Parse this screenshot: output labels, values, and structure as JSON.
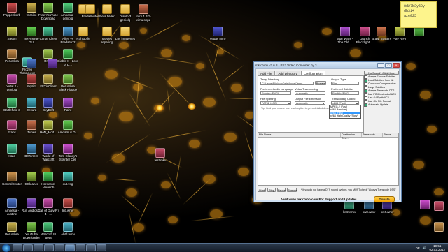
{
  "desktop": {
    "icons": [
      {
        "label": "Pappenkorb",
        "type": "file"
      },
      {
        "label": "Yorbiko",
        "type": "file"
      },
      {
        "label": "Free YouTube Download",
        "type": "file"
      },
      {
        "label": "Amnesia - geniolg",
        "type": "file"
      },
      {
        "label": "",
        "type": "folder"
      },
      {
        "label": "Freifallbilder",
        "type": "folder"
      },
      {
        "label": "Beta bilder",
        "type": "folder"
      },
      {
        "label": "Diablo 3 geniolg",
        "type": "folder"
      },
      {
        "label": "Intro 1 4G-vimu.shpd",
        "type": "file"
      },
      {
        "label": "Steam",
        "type": "file"
      },
      {
        "label": "mkvmerge GUI",
        "type": "file"
      },
      {
        "label": "Curse Client",
        "type": "file"
      },
      {
        "label": "Alien vs Predator 2",
        "type": "file"
      },
      {
        "label": "Rohstoffe",
        "type": "folder"
      },
      {
        "label": "Movies reparing",
        "type": "folder"
      },
      {
        "label": "Los imagenes",
        "type": "folder"
      },
      {
        "label": "Perumbra",
        "type": "file"
      },
      {
        "label": "Origin",
        "type": "file"
      },
      {
        "label": "Diablo II - Lord of D...",
        "type": "file"
      },
      {
        "label": "Frozen Throne.exe",
        "type": "file"
      },
      {
        "label": "",
        "type": "file"
      },
      {
        "label": "",
        "type": "file"
      },
      {
        "label": "portal 2 - geniolg",
        "type": "file"
      },
      {
        "label": "Skyrim",
        "type": "file"
      },
      {
        "label": "FFXivClient",
        "type": "file"
      },
      {
        "label": "Perumbra Black Plague",
        "type": "file"
      },
      {
        "label": "Battlefield 3",
        "type": "file"
      },
      {
        "label": "Dexura",
        "type": "file"
      },
      {
        "label": "SkyDrift",
        "type": "file"
      },
      {
        "label": "Paint",
        "type": "file"
      },
      {
        "label": "Fraps",
        "type": "file"
      },
      {
        "label": "iTunes",
        "type": "file"
      },
      {
        "label": "HoN_Mod...",
        "type": "file"
      },
      {
        "label": "Amdamus D...",
        "type": "file"
      },
      {
        "label": "Halo",
        "type": "file"
      },
      {
        "label": "BitTorrent",
        "type": "file"
      },
      {
        "label": "World of Warcraft",
        "type": "file"
      },
      {
        "label": "Tom Clancy's Splinter Cell",
        "type": "file"
      },
      {
        "label": "test.mkv",
        "type": "file"
      },
      {
        "label": "ControlCenter",
        "type": "file"
      },
      {
        "label": "CCleaner",
        "type": "file"
      },
      {
        "label": "Heroes of Newerth",
        "type": "file"
      },
      {
        "label": "out.vog",
        "type": "file"
      },
      {
        "label": "Amnesia - Justine",
        "type": "file"
      },
      {
        "label": "Run Audiosurf",
        "type": "file"
      },
      {
        "label": "Call of Duty(R) 4 - ...",
        "type": "file"
      },
      {
        "label": "Intl.wmv",
        "type": "file"
      },
      {
        "label": "Perumbra",
        "type": "file"
      },
      {
        "label": "YouTube Downloader",
        "type": "file"
      },
      {
        "label": "Warcraft III Beta",
        "type": "file"
      },
      {
        "label": "Ahtd.wmv",
        "type": "file"
      },
      {
        "label": "Vegas Intro",
        "type": "file"
      },
      {
        "label": "Star Wars - The Old ...",
        "type": "file"
      },
      {
        "label": "Launch Blacklight ...",
        "type": "file"
      },
      {
        "label": "Brawl Busters",
        "type": "file"
      },
      {
        "label": "Play RIFT",
        "type": "file"
      },
      {
        "label": "",
        "type": "file"
      },
      {
        "label": "kw2.wmv",
        "type": "file"
      },
      {
        "label": "kw3.wmv",
        "type": "file"
      },
      {
        "label": "kw4.wmv",
        "type": "file"
      },
      {
        "label": "",
        "type": "file"
      },
      {
        "label": "",
        "type": "file"
      },
      {
        "label": "",
        "type": "file"
      }
    ]
  },
  "sticky_note": {
    "lines": [
      "8d27b3y69y",
      "dh314",
      "aze025"
    ]
  },
  "app": {
    "title": "mkv2vob v2.6.8 - PS3 Video Converter by 3...",
    "tabs": [
      "Add File",
      "Add Directory",
      "Configuration"
    ],
    "active_tab": "Configuration",
    "temp_dir_label": "Temp Directory",
    "temp_dir_value": "C:\\Users\\Flip\\AppData\\Local\\Temp",
    "browse_label": "Browse",
    "output_type_label": "Output Type",
    "output_type_value": "File",
    "pref_audio_label": "Preferred Audio Language",
    "pref_audio_value": "English (ENG)",
    "video_transcoding_label": "Video Transcoding",
    "video_transcoding_value": "Automatic",
    "pref_subtitle_label": "Preferred Subtitle Language",
    "pref_subtitle_value": "English (ENG)",
    "file_splitting_label": "File Splitting",
    "file_splitting_value": "FAT32 (4GB)",
    "output_ext_label": "Output File Extension",
    "output_ext_value": "Automatic",
    "transcoding_codec_label": "Transcoding Codec",
    "transcoding_codec_value": "x264 (Fast)",
    "hint": "Tip: Hold your mouse over each option to get a detailed description",
    "dropdown_options": [
      "MPEG-2 (Fast)",
      "x264 (Medium)",
      "x264 (Fast)",
      "x264 High Quality (Slow)"
    ],
    "dropdown_selected_index": 2,
    "checks_title": "No Sound? Click Here",
    "checks": [
      {
        "label": "Always Encode Subtitles",
        "on": false
      },
      {
        "label": "Load Subtitles from file",
        "on": true
      },
      {
        "label": "Overscan Compensation",
        "on": false
      },
      {
        "label": "Large Subtitles",
        "on": false
      },
      {
        "label": "Always Transcode DTS",
        "on": true
      },
      {
        "label": "Use PCM instead of AC3",
        "on": false
      },
      {
        "label": "Use AVISynth AC3",
        "on": false
      },
      {
        "label": "Use Old File Format",
        "on": false
      },
      {
        "label": "Automatic Update",
        "on": true
      }
    ],
    "grid_columns": [
      "File Name",
      "Destination Dev...",
      "Transcode",
      "Status"
    ],
    "bottom_buttons": [
      "Start",
      "Stop",
      "Pause",
      "Remove"
    ],
    "dts_note": "* If you do not have a DTS sound system, you MUST check \"Always Transcode DTS\"",
    "website": "Visit www.mkv2vob.com For Support and Updates",
    "donate": "Donate"
  },
  "taskbar": {
    "apps": [
      "explorer",
      "firefox",
      "media",
      "chrome",
      "steam",
      "mkv2vob",
      "folder",
      "skype",
      "notes"
    ],
    "open_index": 5,
    "language": "DE",
    "time": "19:51",
    "date": "02.02.2012"
  }
}
